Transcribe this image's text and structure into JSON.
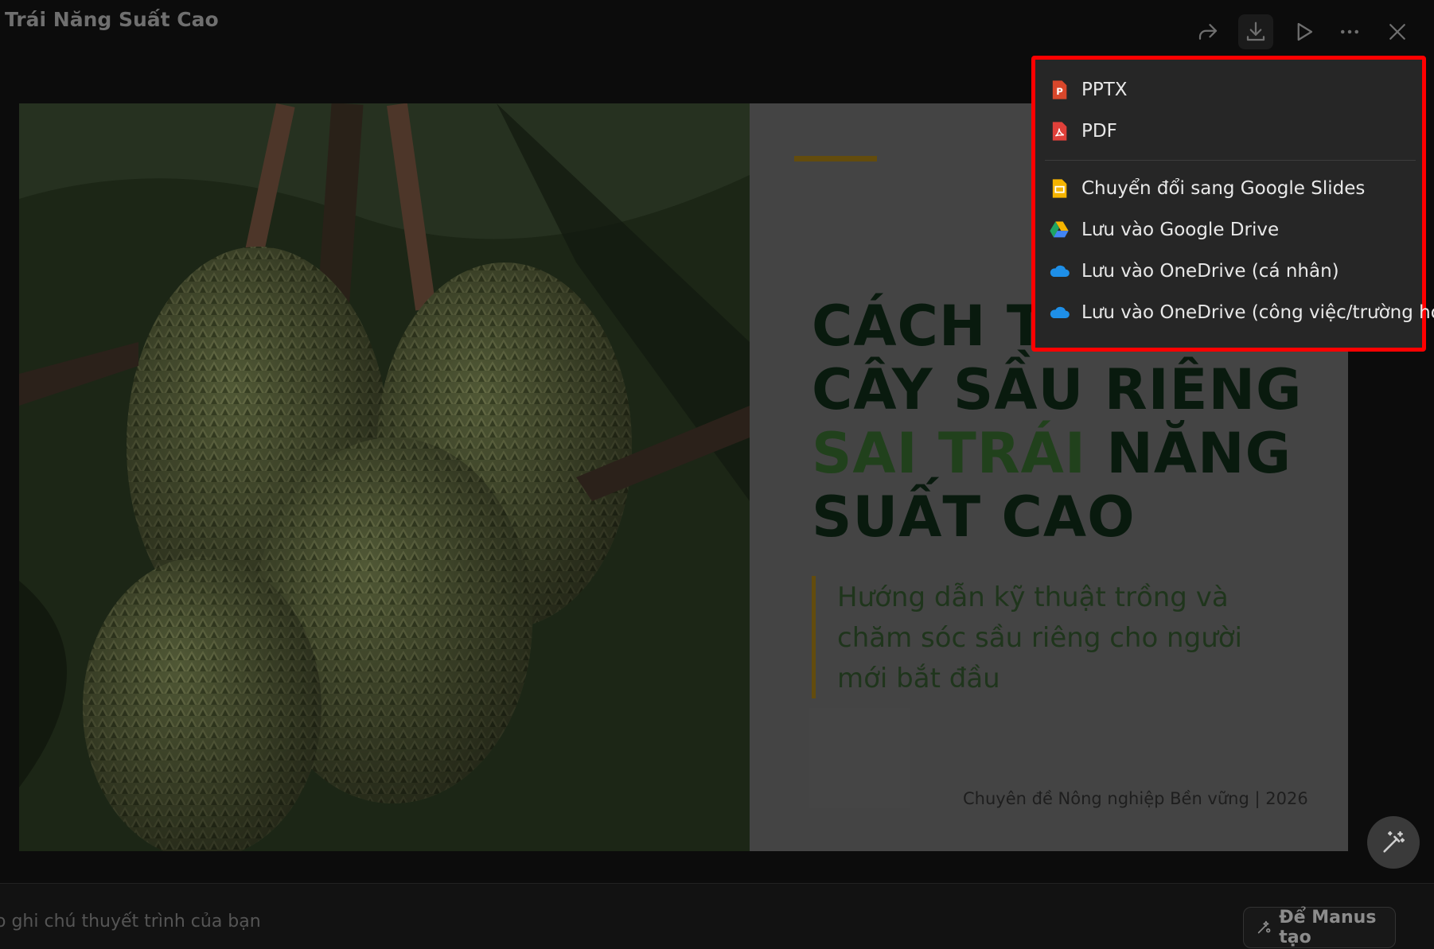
{
  "header": {
    "title": "Trái Năng Suất Cao",
    "icons": [
      "share-icon",
      "download-icon",
      "play-icon",
      "more-icon",
      "close-icon"
    ]
  },
  "slide": {
    "headline_line1": "CÁCH T",
    "headline_line2": "CÂY SẦU RIÊNG",
    "headline_highlight": "SAI TRÁI",
    "headline_line3_rest": " NĂNG",
    "headline_line4": "SUẤT CAO",
    "subtitle": "Hướng dẫn kỹ thuật trồng và chăm sóc sầu riêng cho người mới bắt đầu",
    "footer": "Chuyên đề Nông nghiệp Bền vững | 2026",
    "colors": {
      "accent": "#8a6a12",
      "headline": "#0d2414",
      "highlight": "#2e5a27"
    }
  },
  "export_menu": {
    "items": [
      {
        "label": "PPTX",
        "icon": "pptx-icon"
      },
      {
        "label": "PDF",
        "icon": "pdf-icon"
      },
      {
        "label": "Chuyển đổi sang Google Slides",
        "icon": "google-slides-icon"
      },
      {
        "label": "Lưu vào Google Drive",
        "icon": "google-drive-icon"
      },
      {
        "label": "Lưu vào OneDrive (cá nhân)",
        "icon": "onedrive-icon"
      },
      {
        "label": "Lưu vào OneDrive (công việc/trường học)",
        "icon": "onedrive-icon"
      }
    ]
  },
  "notes": {
    "placeholder": "o ghi chú thuyết trình của bạn",
    "manus_button": "Để Manus tạo"
  }
}
